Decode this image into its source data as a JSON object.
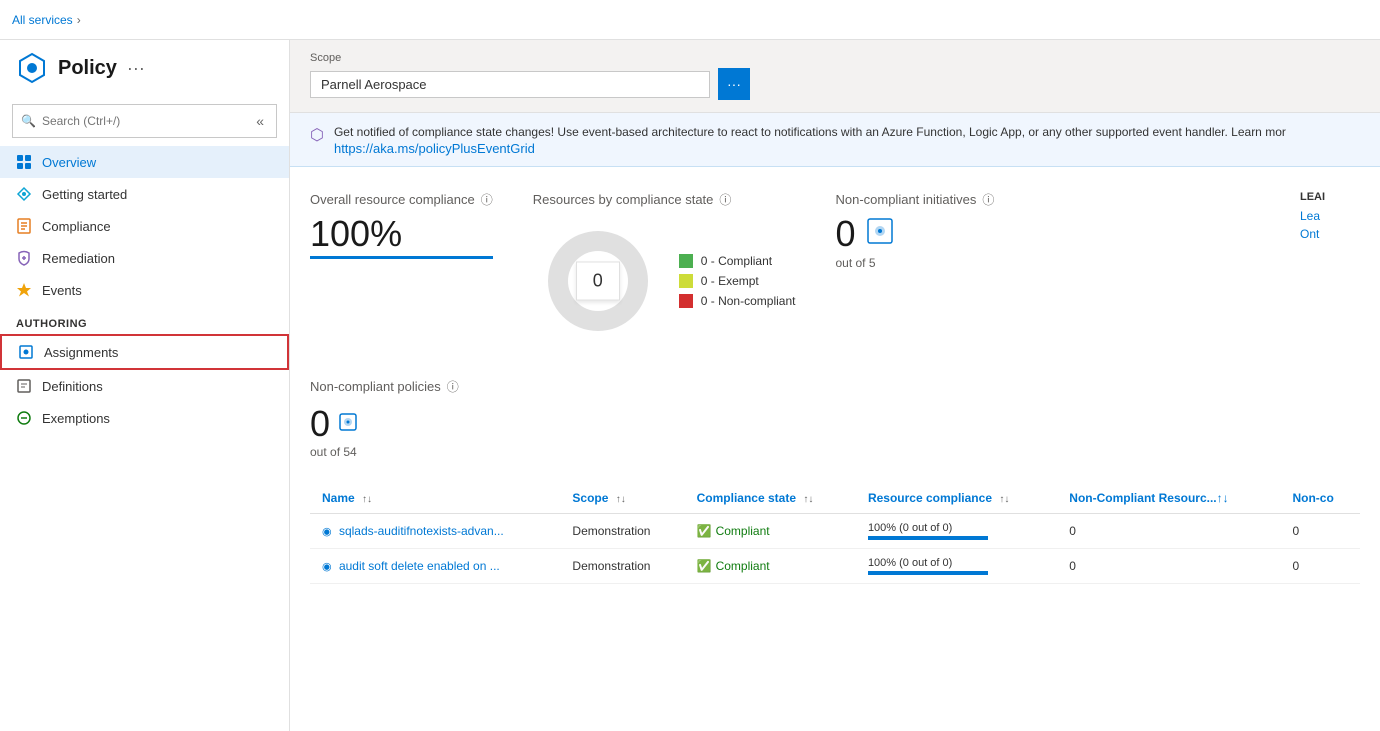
{
  "topbar": {
    "breadcrumb": "All services",
    "chevron": "›"
  },
  "sidebar": {
    "title": "Policy",
    "ellipsis": "···",
    "search_placeholder": "Search (Ctrl+/)",
    "collapse_icon": "«",
    "nav_items": [
      {
        "id": "overview",
        "label": "Overview",
        "icon": "overview"
      },
      {
        "id": "getting-started",
        "label": "Getting started",
        "icon": "getting-started"
      },
      {
        "id": "compliance",
        "label": "Compliance",
        "icon": "compliance"
      },
      {
        "id": "remediation",
        "label": "Remediation",
        "icon": "remediation"
      },
      {
        "id": "events",
        "label": "Events",
        "icon": "events"
      }
    ],
    "authoring_label": "Authoring",
    "authoring_items": [
      {
        "id": "assignments",
        "label": "Assignments",
        "icon": "assignments",
        "selected": true
      },
      {
        "id": "definitions",
        "label": "Definitions",
        "icon": "definitions"
      },
      {
        "id": "exemptions",
        "label": "Exemptions",
        "icon": "exemptions"
      }
    ]
  },
  "scope": {
    "label": "Scope",
    "value": "Parnell Aerospace",
    "btn_icon": "···"
  },
  "notification": {
    "text": "Get notified of compliance state changes! Use event-based architecture to react to notifications with an Azure Function, Logic App, or any other supported event handler. Learn mor",
    "link": "https://aka.ms/policyPlusEventGrid"
  },
  "metrics": {
    "overall_compliance": {
      "title": "Overall resource compliance",
      "value": "100%"
    },
    "resources_by_state": {
      "title": "Resources by compliance state",
      "center_value": "0",
      "legend": [
        {
          "label": "0 - Compliant",
          "color": "#4caf50"
        },
        {
          "label": "0 - Exempt",
          "color": "#cddc39"
        },
        {
          "label": "0 - Non-compliant",
          "color": "#d32f2f"
        }
      ]
    },
    "non_compliant_initiatives": {
      "title": "Non-compliant initiatives",
      "value": "0",
      "out_of": "out of 5"
    },
    "learn_section_label": "LEAI",
    "learn_links": [
      "Lea",
      "Ont"
    ]
  },
  "non_compliant_policies": {
    "title": "Non-compliant policies",
    "value": "0",
    "out_of": "out of 54"
  },
  "table": {
    "columns": [
      {
        "id": "name",
        "label": "Name"
      },
      {
        "id": "scope",
        "label": "Scope"
      },
      {
        "id": "compliance_state",
        "label": "Compliance state"
      },
      {
        "id": "resource_compliance",
        "label": "Resource compliance"
      },
      {
        "id": "non_compliant_resources",
        "label": "Non-Compliant Resourc...↑↓"
      },
      {
        "id": "non_co",
        "label": "Non-co"
      }
    ],
    "rows": [
      {
        "name": "sqlads-auditifnotexists-advan...",
        "scope": "Demonstration",
        "compliance_state": "Compliant",
        "resource_compliance_text": "100% (0 out of 0)",
        "resource_compliance_pct": 100,
        "non_compliant_resources": "0",
        "non_co": "0"
      },
      {
        "name": "audit soft delete enabled on ...",
        "scope": "Demonstration",
        "compliance_state": "Compliant",
        "resource_compliance_text": "100% (0 out of 0)",
        "resource_compliance_pct": 100,
        "non_compliant_resources": "0",
        "non_co": "0"
      }
    ]
  }
}
